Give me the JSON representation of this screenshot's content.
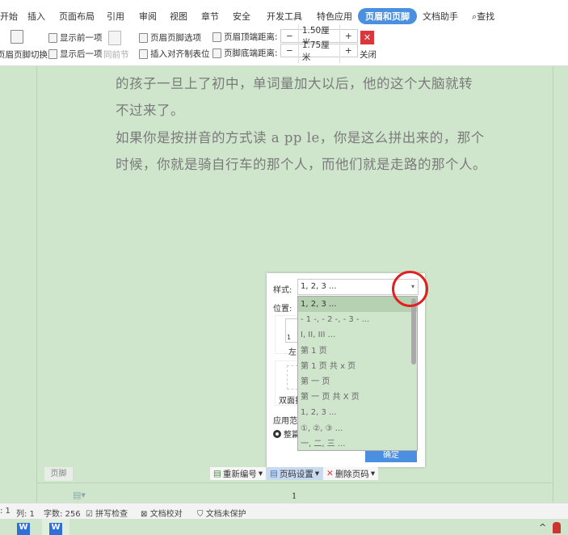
{
  "menu_tabs": [
    "开始",
    "插入",
    "页面布局",
    "引用",
    "审阅",
    "视图",
    "章节",
    "安全",
    "开发工具",
    "特色应用",
    "页眉和页脚",
    "文档助手",
    "查找"
  ],
  "active_tab": "页眉和页脚",
  "ribbon": {
    "switch": "页眉页脚切换",
    "show_prev": "显示前一项",
    "show_next": "显示后一项",
    "same_prev": "同前节",
    "options": "页眉页脚选项",
    "insert_tab": "插入对齐制表位",
    "header_top_label": "页眉顶端距离:",
    "header_top_value": "1.50厘米",
    "footer_bottom_label": "页脚底端距离:",
    "footer_bottom_value": "1.75厘米",
    "minus": "−",
    "plus": "+",
    "close": "关闭"
  },
  "document_lines": [
    "的孩子一旦上了初中，单词量加大以后，他的这个大脑就转",
    "不过来了。",
    "如果你是按拼音的方式读 a pp le，你是这么拼出来的，那个",
    "时候，你就是骑自行车的那个人，而他们就是走路的那个人。"
  ],
  "dialog": {
    "style_label": "样式:",
    "style_value": "1, 2, 3 ...",
    "position_label": "位置:",
    "left_label": "左",
    "duplex_label": "双面打",
    "scope_label": "应用范",
    "whole_label": "整篇",
    "ok": "确定",
    "preview_num": "1"
  },
  "style_options": [
    "1, 2, 3 ...",
    "- 1 -, - 2 -, - 3 - ...",
    "I, II, III ...",
    "第 1 页",
    "第 1 页 共 x 页",
    "第 一 页",
    "第 一 页 共 X 页",
    "1, 2, 3 ...",
    "①, ②, ③ ...",
    "一, 二, 三 ..."
  ],
  "footer": {
    "label": "页脚",
    "renumber": "重新编号",
    "page_setup": "页码设置",
    "delete": "删除页码",
    "page_number": "1"
  },
  "status": {
    "row": ": 1",
    "col": "列: 1",
    "words": "字数: 256",
    "spell": "拼写检查",
    "proof": "文档校对",
    "protect": "文档未保护"
  },
  "colors": {
    "accent": "#4a8fe0",
    "eye_care_bg": "#cfe6cc",
    "highlight_circle": "#e02020",
    "close": "#d9363e"
  }
}
